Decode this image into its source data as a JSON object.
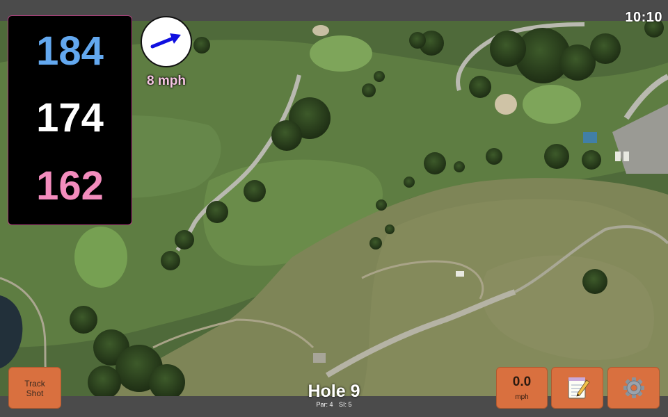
{
  "status": {
    "time": "10:10"
  },
  "distances": {
    "back": "184",
    "middle": "174",
    "front": "162"
  },
  "wind": {
    "speed_label": "8 mph",
    "arrow_icon": "wind-direction-arrow-icon",
    "arrow_color": "#1010e0"
  },
  "hole": {
    "title": "Hole 9",
    "par": "Par: 4",
    "stroke_index": "SI: 5"
  },
  "buttons": {
    "track_shot_line1": "Track",
    "track_shot_line2": "Shot",
    "speed_value": "0.0",
    "speed_unit": "mph",
    "notes_icon": "notepad-icon",
    "settings_icon": "gear-icon"
  },
  "colors": {
    "back_distance": "#63a8ef",
    "middle_distance": "#ffffff",
    "front_distance": "#f38cbd",
    "button_bg": "#d9703f",
    "panel_border": "#b0407e"
  }
}
